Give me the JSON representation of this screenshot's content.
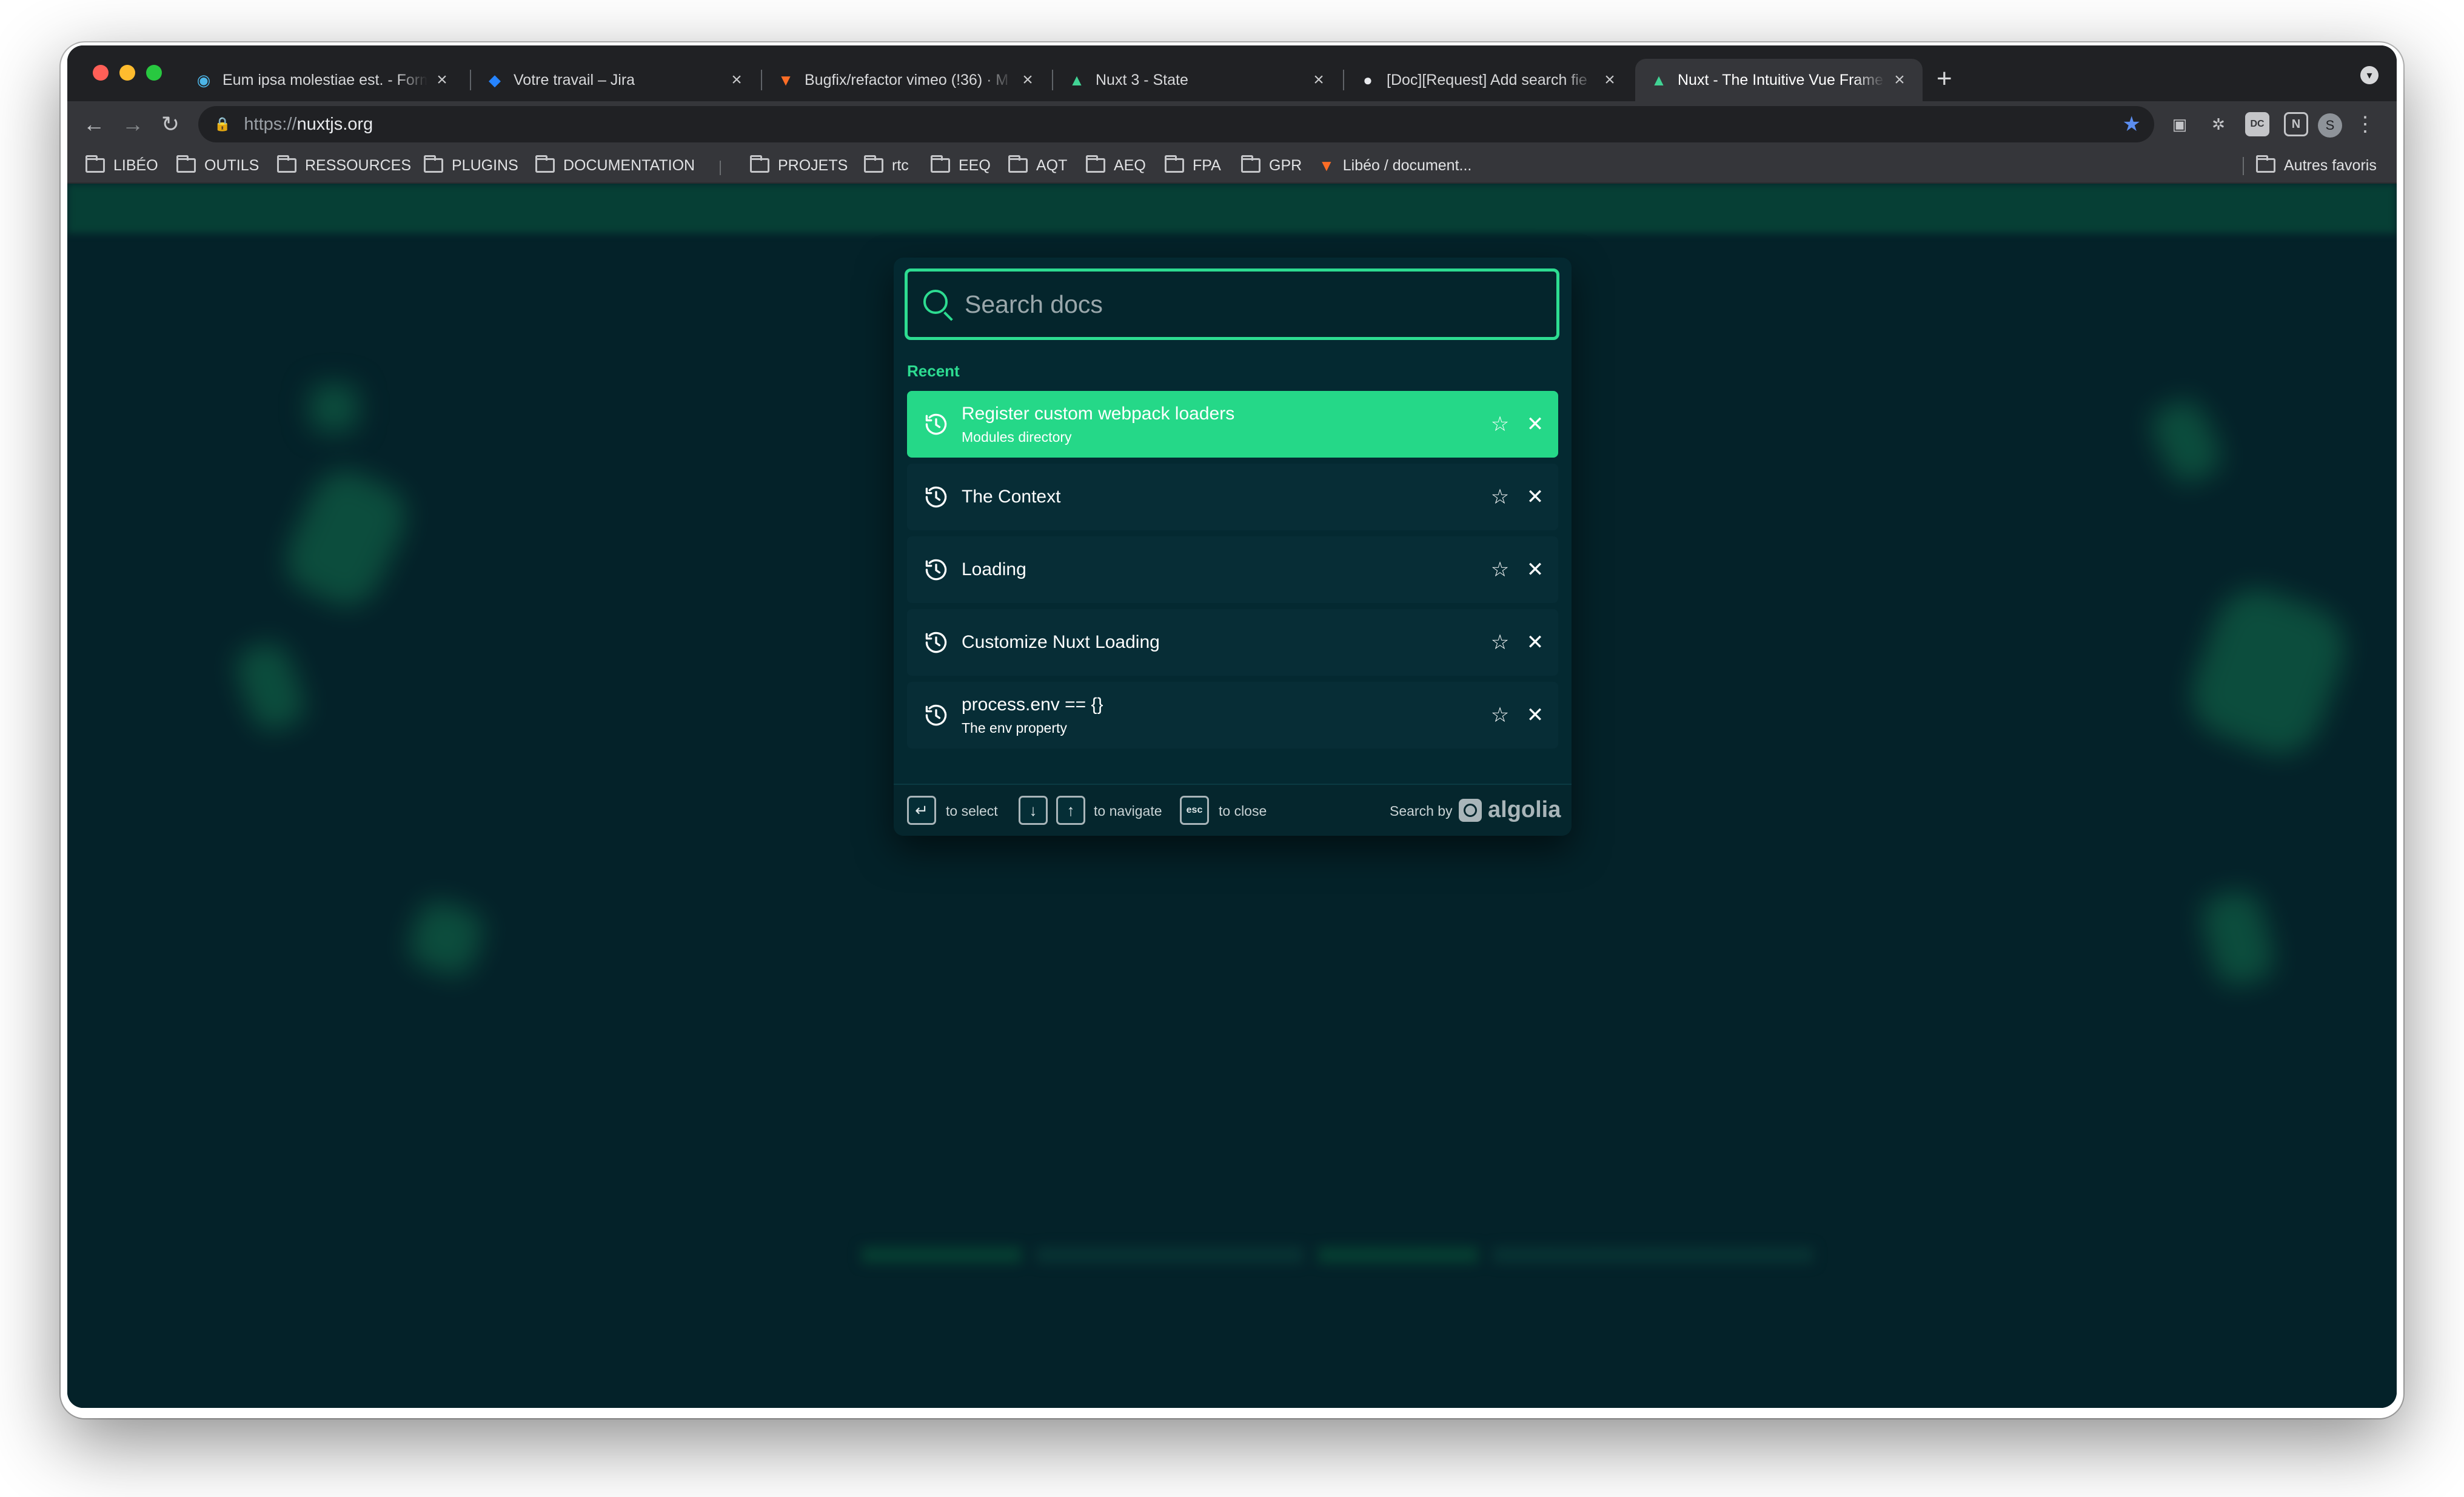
{
  "browser": {
    "tabs": [
      {
        "title": "Eum ipsa molestiae est. - Form",
        "icon": "broadcast-icon",
        "active": false
      },
      {
        "title": "Votre travail – Jira",
        "icon": "jira-icon",
        "active": false
      },
      {
        "title": "Bugfix/refactor vimeo (!36) · M",
        "icon": "gitlab-icon",
        "active": false
      },
      {
        "title": "Nuxt 3 - State",
        "icon": "nuxt-icon",
        "active": false
      },
      {
        "title": "[Doc][Request] Add search fie",
        "icon": "github-icon",
        "active": false
      },
      {
        "title": "Nuxt - The Intuitive Vue Frame",
        "icon": "nuxt-icon",
        "active": true
      }
    ],
    "url_prefix": "https://",
    "url_host": "nuxtjs.org",
    "profile_initial": "S",
    "bookmarks": [
      {
        "label": "LIBÉO",
        "type": "folder"
      },
      {
        "label": "OUTILS",
        "type": "folder"
      },
      {
        "label": "RESSOURCES",
        "type": "folder"
      },
      {
        "label": "PLUGINS",
        "type": "folder"
      },
      {
        "label": "DOCUMENTATION",
        "type": "folder"
      },
      {
        "label": "PROJETS",
        "type": "folder"
      },
      {
        "label": "rtc",
        "type": "folder"
      },
      {
        "label": "EEQ",
        "type": "folder"
      },
      {
        "label": "AQT",
        "type": "folder"
      },
      {
        "label": "AEQ",
        "type": "folder"
      },
      {
        "label": "FPA",
        "type": "folder"
      },
      {
        "label": "GPR",
        "type": "folder"
      },
      {
        "label": "Libéo / document...",
        "type": "link"
      }
    ],
    "other_bookmarks": "Autres favoris",
    "colors": {
      "tab_strip": "#202124",
      "toolbar": "#35363a",
      "bookmark_star": "#5b8def"
    }
  },
  "search": {
    "placeholder": "Search docs",
    "recent_label": "Recent",
    "hits": [
      {
        "title": "Register custom webpack loaders",
        "subtitle": "Modules directory",
        "selected": true
      },
      {
        "title": "The Context",
        "subtitle": "",
        "selected": false
      },
      {
        "title": "Loading",
        "subtitle": "",
        "selected": false
      },
      {
        "title": "Customize Nuxt Loading",
        "subtitle": "",
        "selected": false
      },
      {
        "title": "process.env == {}",
        "subtitle": "The env property",
        "selected": false
      }
    ],
    "footer": {
      "select_key": "↵",
      "select_label": "to select",
      "down_key": "↓",
      "up_key": "↑",
      "navigate_label": "to navigate",
      "esc_key": "esc",
      "close_label": "to close",
      "search_by": "Search by",
      "provider": "algolia"
    },
    "colors": {
      "accent": "#2ddc91",
      "selected_hit": "#25d888",
      "modal_bg": "#042931"
    }
  }
}
